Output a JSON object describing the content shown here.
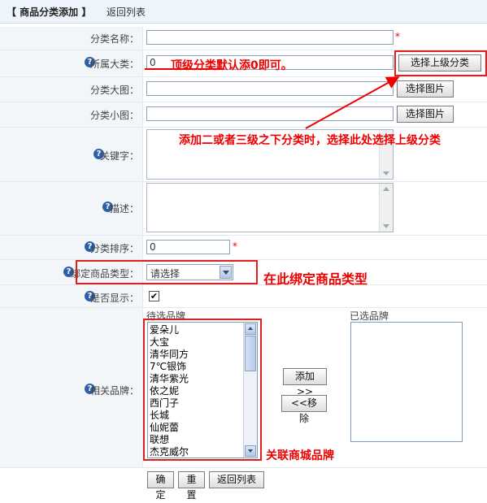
{
  "header": {
    "title": "【 商品分类添加 】",
    "back_link": "返回列表"
  },
  "form": {
    "name": {
      "label": "分类名称：",
      "value": "",
      "required": "*"
    },
    "parent": {
      "label": "所属大类：",
      "value": "0",
      "button": "选择上级分类"
    },
    "big_image": {
      "label": "分类大图：",
      "button": "选择图片"
    },
    "small_image": {
      "label": "分类小图：",
      "button": "选择图片"
    },
    "keywords": {
      "label": "关键字："
    },
    "description": {
      "label": "描述："
    },
    "sort": {
      "label": "分类排序：",
      "value": "0",
      "required": "*"
    },
    "goods_type": {
      "label": "绑定商品类型：",
      "selected": "请选择"
    },
    "visible": {
      "label": "是否显示：",
      "checked": "✔"
    },
    "brands": {
      "label": "相关品牌：",
      "candidates_title": "待选品牌",
      "selected_title": "已选品牌",
      "candidates": [
        "爱朵儿",
        "大宝",
        "清华同方",
        "7℃银饰",
        "清华紫光",
        "依之妮",
        "西门子",
        "长城",
        "仙妮蕾",
        "联想",
        "杰克威尔"
      ],
      "add_button": "添加>>",
      "remove_button": "<<移除"
    }
  },
  "actions": {
    "confirm": "确定",
    "reset": "重置",
    "back": "返回列表"
  },
  "annotations": {
    "top_level": "顶级分类默认添0即可。",
    "sub_level": "添加二或者三级之下分类时，选择此处选择上级分类",
    "bind_type": "在此绑定商品类型",
    "brands": "关联商城品牌"
  },
  "colors": {
    "annotation": "#e00000",
    "header_bg": "#eef4fb",
    "label_bg": "#f3f6f9"
  },
  "icons": {
    "help": "help-question-icon"
  }
}
